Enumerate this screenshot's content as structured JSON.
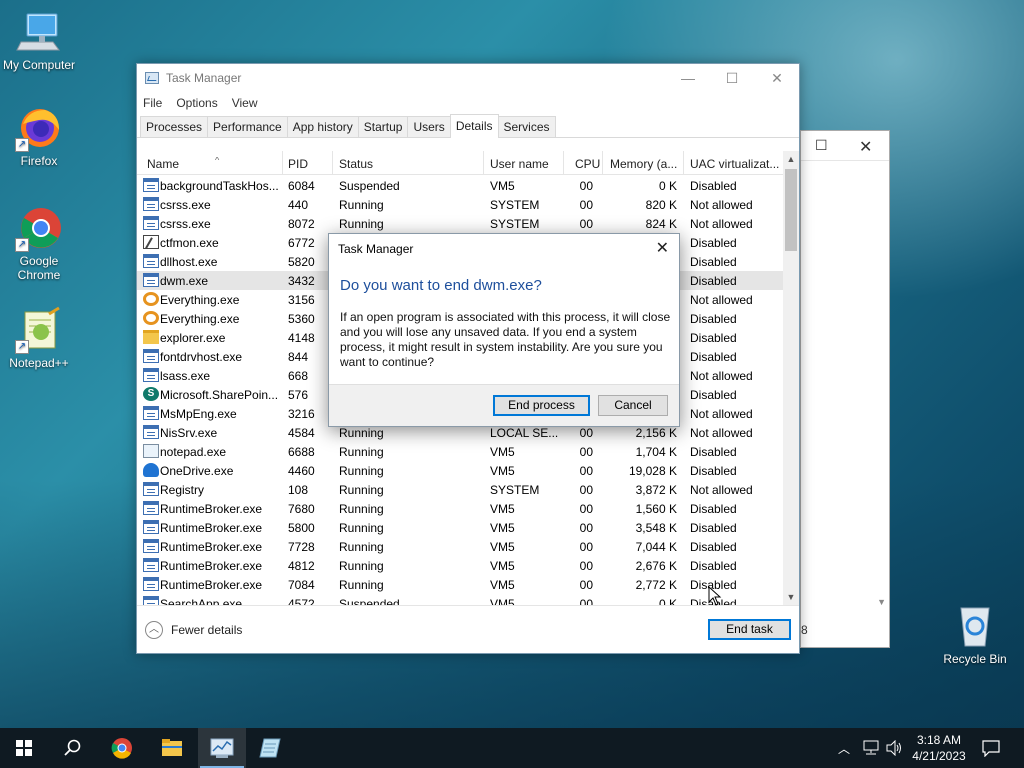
{
  "desktop": {
    "icons": [
      {
        "label": "My Computer"
      },
      {
        "label": "Firefox"
      },
      {
        "label": "Google Chrome"
      },
      {
        "label": "Notepad++"
      },
      {
        "label": "Recycle Bin"
      }
    ]
  },
  "bg_window": {
    "fragment": "8"
  },
  "task_manager": {
    "title": "Task Manager",
    "menu": [
      "File",
      "Options",
      "View"
    ],
    "tabs": [
      "Processes",
      "Performance",
      "App history",
      "Startup",
      "Users",
      "Details",
      "Services"
    ],
    "active_tab": "Details",
    "columns": [
      "Name",
      "PID",
      "Status",
      "User name",
      "CPU",
      "Memory (a...",
      "UAC virtualizat..."
    ],
    "rows": [
      {
        "icon": "window-icon",
        "name": "backgroundTaskHos...",
        "pid": "6084",
        "status": "Suspended",
        "user": "VM5",
        "cpu": "00",
        "mem": "0 K",
        "uac": "Disabled"
      },
      {
        "icon": "window-icon",
        "name": "csrss.exe",
        "pid": "440",
        "status": "Running",
        "user": "SYSTEM",
        "cpu": "00",
        "mem": "820 K",
        "uac": "Not allowed"
      },
      {
        "icon": "window-icon",
        "name": "csrss.exe",
        "pid": "8072",
        "status": "Running",
        "user": "SYSTEM",
        "cpu": "00",
        "mem": "824 K",
        "uac": "Not allowed"
      },
      {
        "icon": "ctfmon-icon",
        "name": "ctfmon.exe",
        "pid": "6772",
        "status": "",
        "user": "",
        "cpu": "",
        "mem": "",
        "uac": "Disabled"
      },
      {
        "icon": "window-icon",
        "name": "dllhost.exe",
        "pid": "5820",
        "status": "",
        "user": "",
        "cpu": "",
        "mem": "",
        "uac": "Disabled"
      },
      {
        "icon": "window-icon",
        "name": "dwm.exe",
        "pid": "3432",
        "status": "",
        "user": "",
        "cpu": "",
        "mem": "",
        "uac": "Disabled",
        "selected": true
      },
      {
        "icon": "everything-icon",
        "name": "Everything.exe",
        "pid": "3156",
        "status": "",
        "user": "",
        "cpu": "",
        "mem": "",
        "uac": "Not allowed"
      },
      {
        "icon": "everything-icon",
        "name": "Everything.exe",
        "pid": "5360",
        "status": "",
        "user": "",
        "cpu": "",
        "mem": "",
        "uac": "Disabled"
      },
      {
        "icon": "folder-icon",
        "name": "explorer.exe",
        "pid": "4148",
        "status": "",
        "user": "",
        "cpu": "",
        "mem": "",
        "uac": "Disabled"
      },
      {
        "icon": "window-icon",
        "name": "fontdrvhost.exe",
        "pid": "844",
        "status": "",
        "user": "",
        "cpu": "",
        "mem": "",
        "uac": "Disabled"
      },
      {
        "icon": "window-icon",
        "name": "lsass.exe",
        "pid": "668",
        "status": "",
        "user": "",
        "cpu": "",
        "mem": "",
        "uac": "Not allowed"
      },
      {
        "icon": "sharepoint-icon",
        "name": "Microsoft.SharePoin...",
        "pid": "576",
        "status": "",
        "user": "",
        "cpu": "",
        "mem": "",
        "uac": "Disabled"
      },
      {
        "icon": "window-icon",
        "name": "MsMpEng.exe",
        "pid": "3216",
        "status": "",
        "user": "",
        "cpu": "",
        "mem": "",
        "uac": "Not allowed"
      },
      {
        "icon": "window-icon",
        "name": "NisSrv.exe",
        "pid": "4584",
        "status": "Running",
        "user": "LOCAL SE...",
        "cpu": "00",
        "mem": "2,156 K",
        "uac": "Not allowed"
      },
      {
        "icon": "notepad-icon",
        "name": "notepad.exe",
        "pid": "6688",
        "status": "Running",
        "user": "VM5",
        "cpu": "00",
        "mem": "1,704 K",
        "uac": "Disabled"
      },
      {
        "icon": "onedrive-icon",
        "name": "OneDrive.exe",
        "pid": "4460",
        "status": "Running",
        "user": "VM5",
        "cpu": "00",
        "mem": "19,028 K",
        "uac": "Disabled"
      },
      {
        "icon": "window-icon",
        "name": "Registry",
        "pid": "108",
        "status": "Running",
        "user": "SYSTEM",
        "cpu": "00",
        "mem": "3,872 K",
        "uac": "Not allowed"
      },
      {
        "icon": "window-icon",
        "name": "RuntimeBroker.exe",
        "pid": "7680",
        "status": "Running",
        "user": "VM5",
        "cpu": "00",
        "mem": "1,560 K",
        "uac": "Disabled"
      },
      {
        "icon": "window-icon",
        "name": "RuntimeBroker.exe",
        "pid": "5800",
        "status": "Running",
        "user": "VM5",
        "cpu": "00",
        "mem": "3,548 K",
        "uac": "Disabled"
      },
      {
        "icon": "window-icon",
        "name": "RuntimeBroker.exe",
        "pid": "7728",
        "status": "Running",
        "user": "VM5",
        "cpu": "00",
        "mem": "7,044 K",
        "uac": "Disabled"
      },
      {
        "icon": "window-icon",
        "name": "RuntimeBroker.exe",
        "pid": "4812",
        "status": "Running",
        "user": "VM5",
        "cpu": "00",
        "mem": "2,676 K",
        "uac": "Disabled"
      },
      {
        "icon": "window-icon",
        "name": "RuntimeBroker.exe",
        "pid": "7084",
        "status": "Running",
        "user": "VM5",
        "cpu": "00",
        "mem": "2,772 K",
        "uac": "Disabled"
      },
      {
        "icon": "window-icon",
        "name": "SearchApp.exe",
        "pid": "4572",
        "status": "Suspended",
        "user": "VM5",
        "cpu": "00",
        "mem": "0 K",
        "uac": "Disabled"
      }
    ],
    "footer": {
      "fewer_details": "Fewer details",
      "end_task": "End task"
    }
  },
  "dialog": {
    "title": "Task Manager",
    "heading": "Do you want to end dwm.exe?",
    "body": "If an open program is associated with this process, it will close and you will lose any unsaved data. If you end a system process, it might result in system instability. Are you sure you want to continue?",
    "end_process": "End process",
    "cancel": "Cancel"
  },
  "taskbar": {
    "time": "3:18 AM",
    "date": "4/21/2023"
  }
}
